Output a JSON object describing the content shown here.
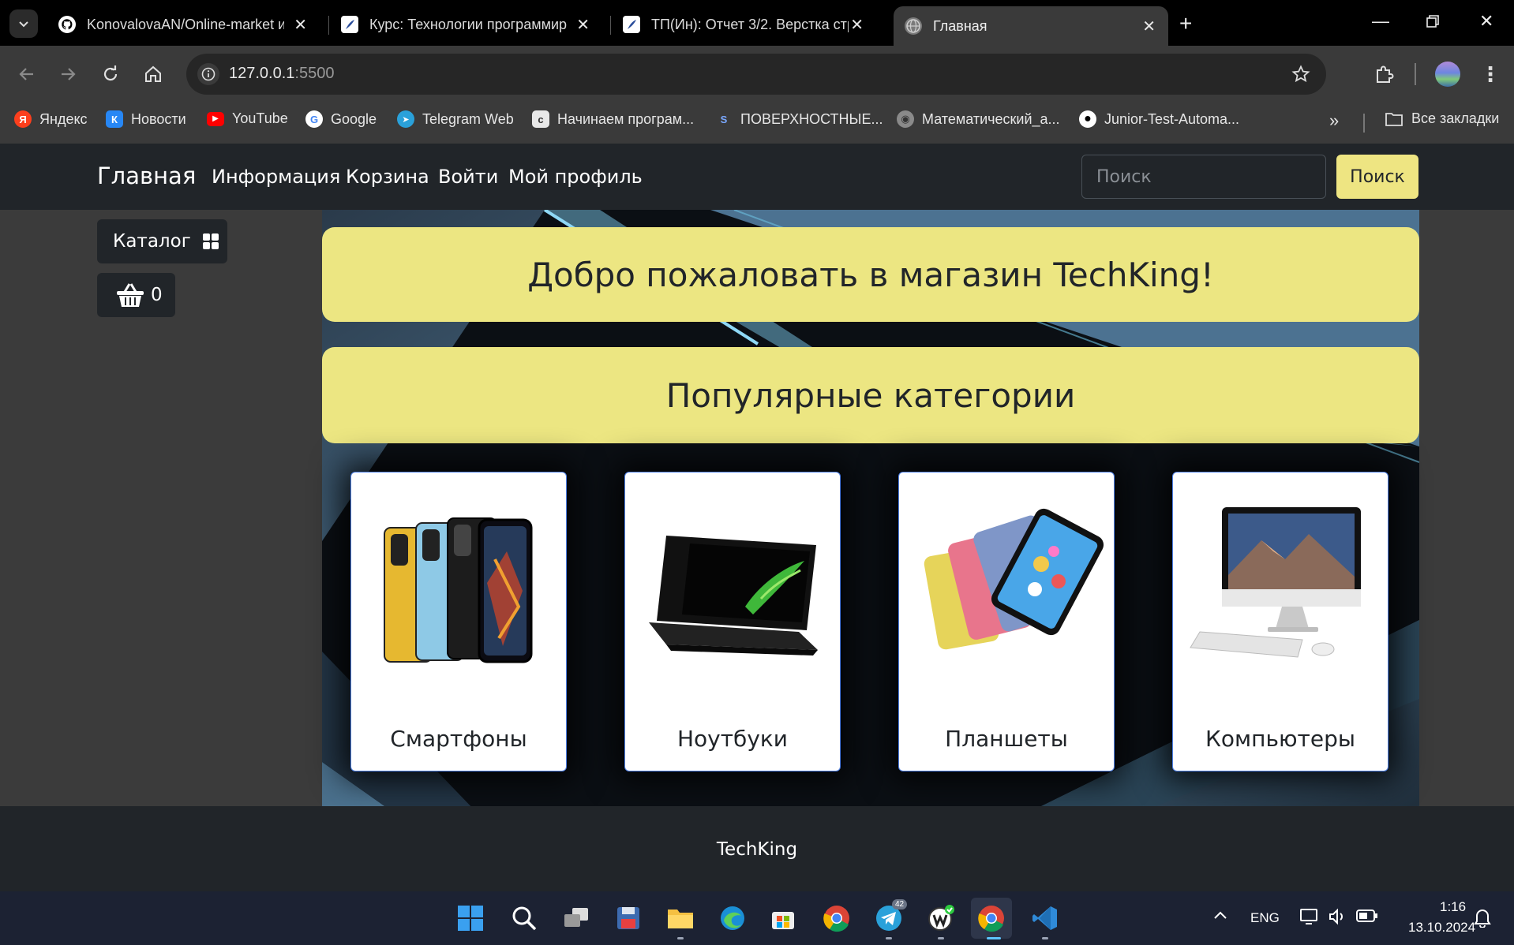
{
  "browser": {
    "tabs": [
      {
        "title": "KonovalovaAN/Online-market и",
        "icon": "github-icon",
        "active": false
      },
      {
        "title": "Курс: Технологии программир",
        "icon": "moodle-feather-icon",
        "active": false
      },
      {
        "title": "ТП(Ин): Отчет 3/2. Верстка стр",
        "icon": "moodle-feather-icon",
        "active": false
      },
      {
        "title": "Главная",
        "icon": "globe-icon",
        "active": true
      }
    ],
    "address": {
      "host": "127.0.0.1",
      "port": ":5500"
    },
    "bookmarks": [
      {
        "label": "Яндекс",
        "icon": "yandex-icon",
        "color": "#fc3f1d",
        "glyph": "Я"
      },
      {
        "label": "Новости",
        "icon": "vk-icon",
        "color": "#2787f5",
        "glyph": "К"
      },
      {
        "label": "YouTube",
        "icon": "youtube-icon",
        "color": "#ff0000",
        "glyph": "▶"
      },
      {
        "label": "Google",
        "icon": "google-icon",
        "color": "#4285f4",
        "glyph": "G"
      },
      {
        "label": "Telegram Web",
        "icon": "telegram-icon",
        "color": "#2aa1da",
        "glyph": "➤"
      },
      {
        "label": "Начинаем програм...",
        "icon": "stepik-icon",
        "color": "#555555",
        "glyph": "c"
      },
      {
        "label": "ПОВЕРХНОСТНЫЕ...",
        "icon": "link-icon",
        "color": "#3a3a3a",
        "glyph": "S"
      },
      {
        "label": "Математический_а...",
        "icon": "globe-icon",
        "color": "#666666",
        "glyph": "◉"
      },
      {
        "label": "Junior-Test-Automa...",
        "icon": "github-icon",
        "color": "#222222",
        "glyph": "●"
      }
    ],
    "all_bookmarks": "Все закладки"
  },
  "site": {
    "brand": "Главная",
    "nav": [
      "Информация",
      "Корзина",
      "Войти",
      "Мой профиль"
    ],
    "search_placeholder": "Поиск",
    "search_button": "Поиск",
    "catalog_label": "Каталог",
    "cart_count": "0",
    "welcome": "Добро пожаловать в магазин TechKing!",
    "popular_title": "Популярные категории",
    "categories": [
      {
        "label": "Смартфоны",
        "image": "smartphones-image"
      },
      {
        "label": "Ноутбуки",
        "image": "laptop-image"
      },
      {
        "label": "Планшеты",
        "image": "tablets-image"
      },
      {
        "label": "Компьютеры",
        "image": "desktop-computer-image"
      }
    ],
    "footer": "TechKing",
    "colors": {
      "accent": "#eee582",
      "dark": "#212529",
      "card_border": "#4d7fe6"
    }
  },
  "taskbar": {
    "lang": "ENG",
    "time": "1:16",
    "date": "13.10.2024",
    "telegram_badge": "42"
  }
}
